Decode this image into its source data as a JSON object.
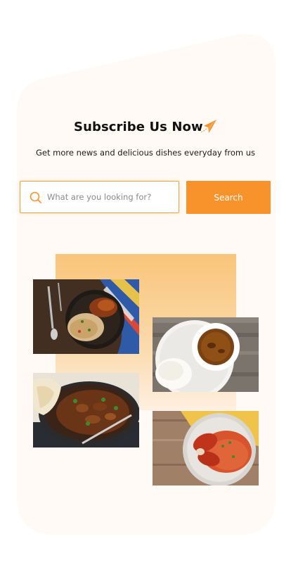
{
  "subscribe": {
    "title": "Subscribe Us Now",
    "subtitle": "Get more news and delicious dishes everyday from us",
    "icon": "paper-plane-icon"
  },
  "search": {
    "placeholder": "What are you looking for?",
    "value": "",
    "button_label": "Search",
    "icon": "search-icon"
  },
  "colors": {
    "accent": "#F7932A",
    "card_background": "#FFFAF5"
  },
  "gallery": [
    {
      "name": "dish-photo-grilled-chicken-rice",
      "dish": "grilled chicken with rice"
    },
    {
      "name": "dish-photo-pounded-yam-soup",
      "dish": "pounded yam with soup"
    },
    {
      "name": "dish-photo-meat-stew-naan",
      "dish": "meat stew with naan"
    },
    {
      "name": "dish-photo-jollof-rice-chicken",
      "dish": "jollof rice with chicken"
    }
  ]
}
